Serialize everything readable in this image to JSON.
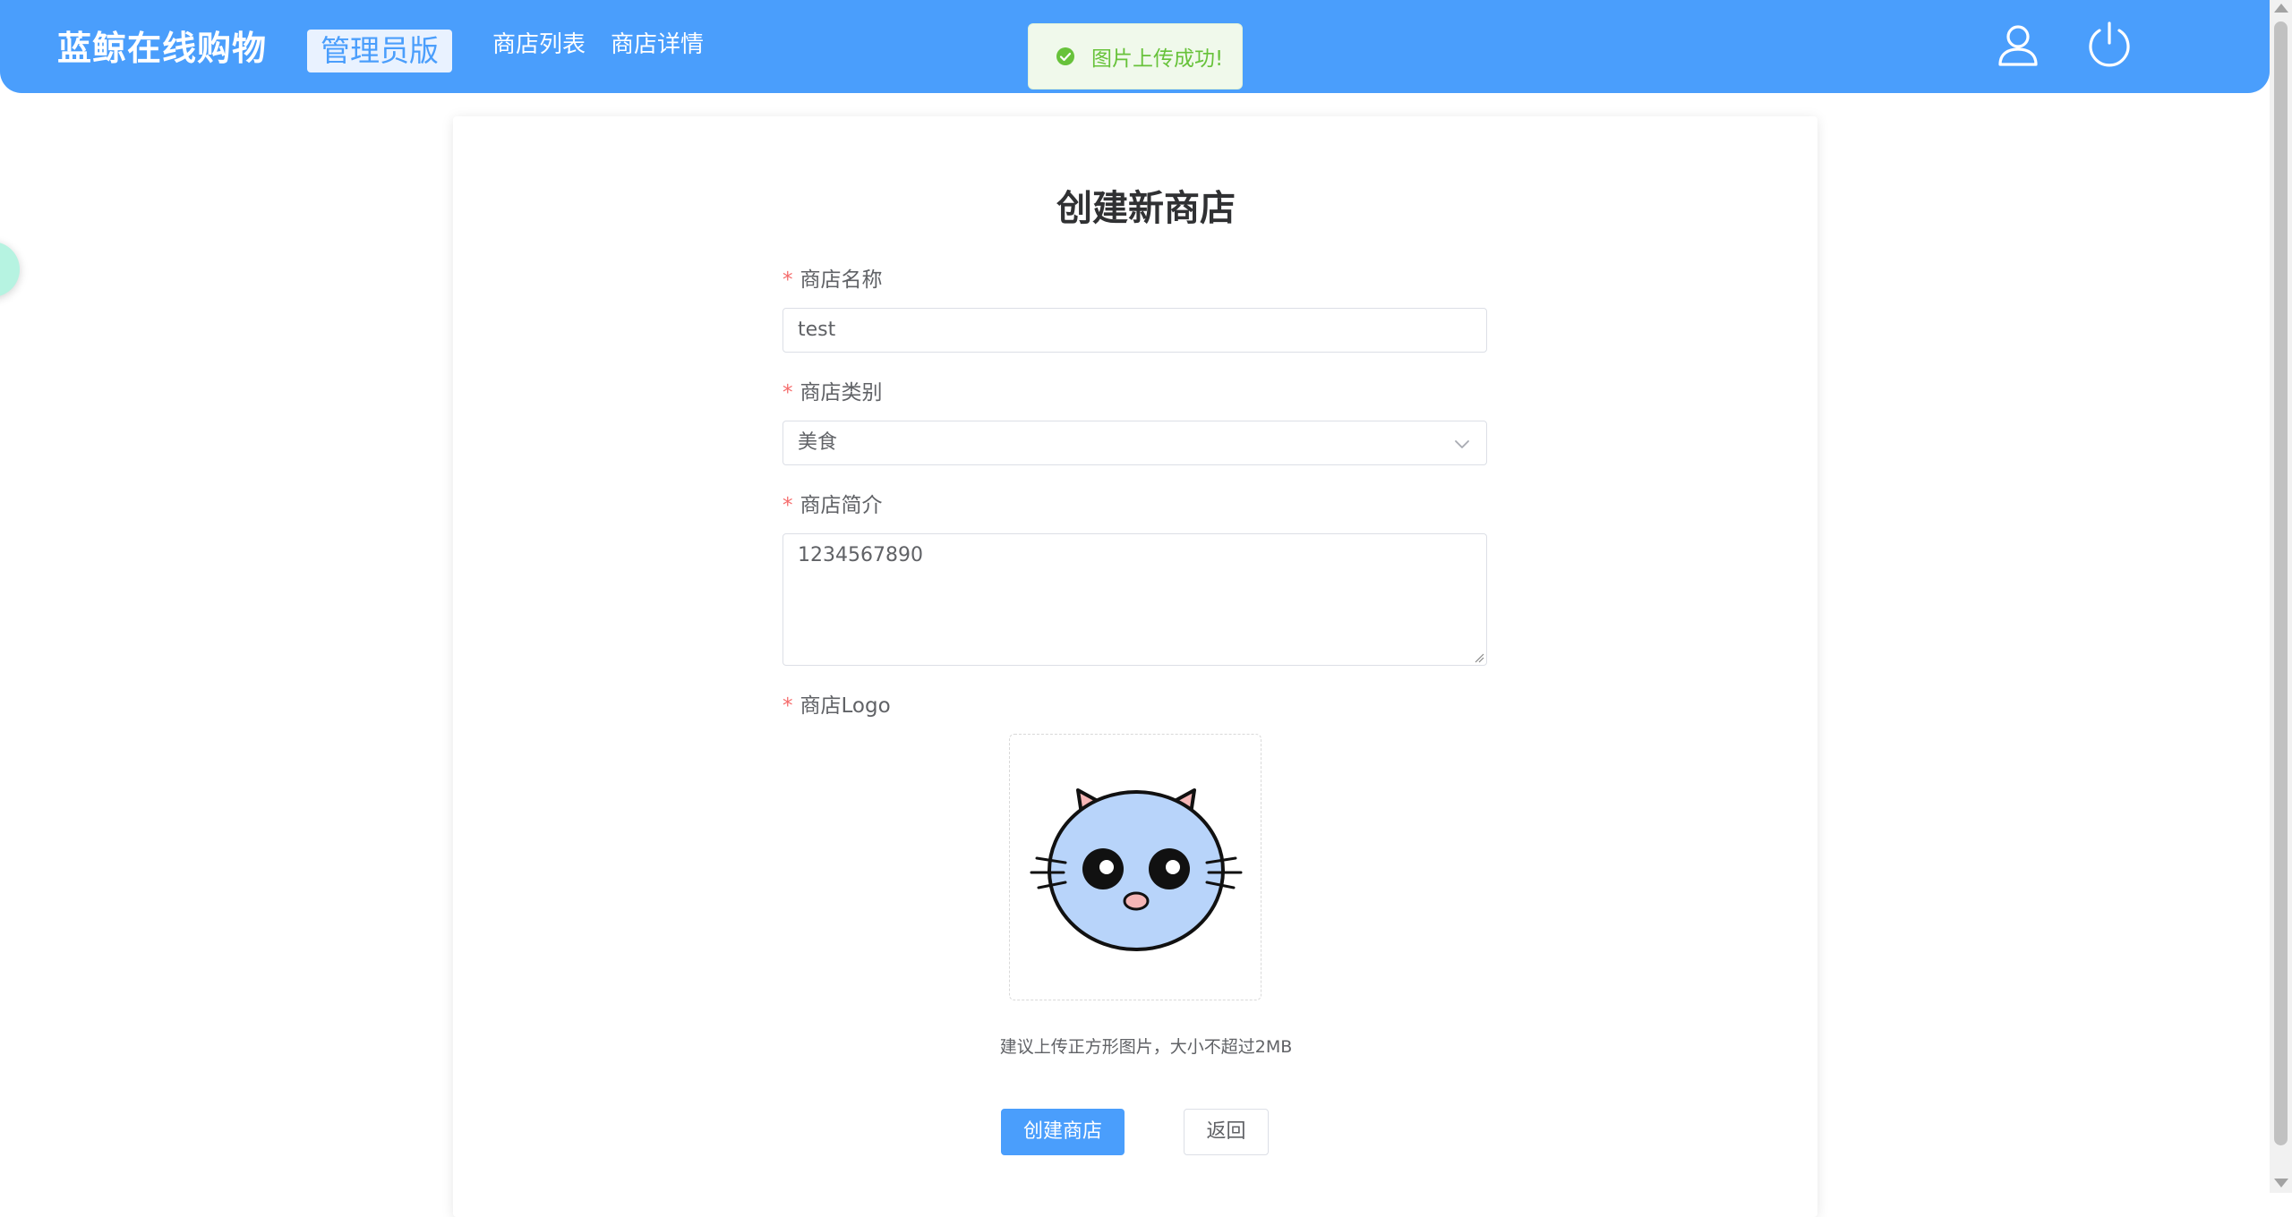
{
  "header": {
    "brand": "蓝鲸在线购物",
    "badge": "管理员版",
    "nav": [
      "商店列表",
      "商店详情"
    ],
    "icons": [
      "user-icon",
      "power-icon"
    ],
    "color": "#4a9efc"
  },
  "toast": {
    "message": "图片上传成功!",
    "type": "success",
    "icon": "check-circle-icon"
  },
  "form": {
    "title": "创建新商店",
    "required_mark": "*",
    "name_label": "商店名称",
    "name_value": "test",
    "category_label": "商店类别",
    "category_value": "美食",
    "description_label": "商店简介",
    "description_value": "1234567890",
    "logo_label": "商店Logo",
    "logo_hint": "建议上传正方形图片，大小不超过2MB",
    "submit_label": "创建商店",
    "back_label": "返回"
  }
}
